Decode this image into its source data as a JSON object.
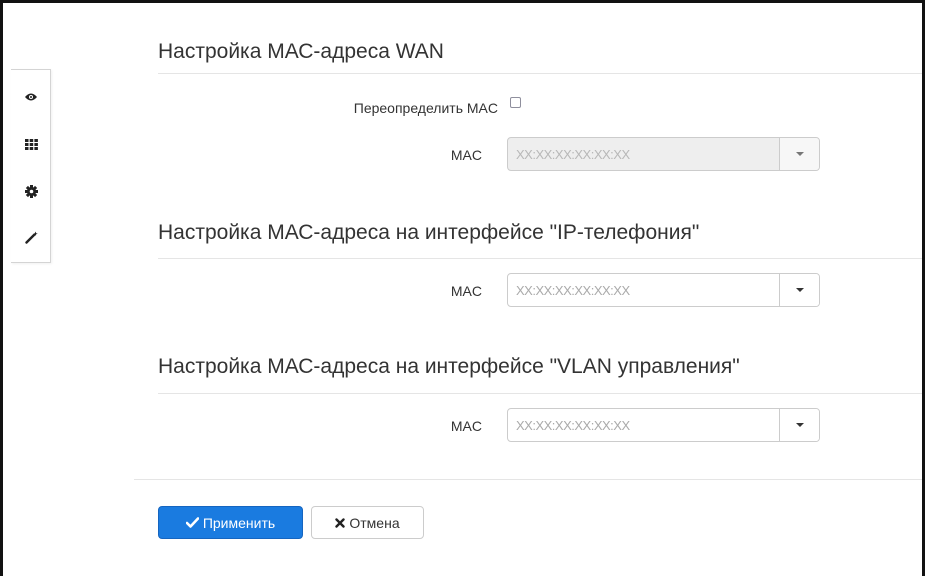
{
  "sidebar": {
    "items": [
      {
        "icon": "eye-icon"
      },
      {
        "icon": "grid-icon"
      },
      {
        "icon": "gear-icon"
      },
      {
        "icon": "wand-icon"
      }
    ]
  },
  "wan": {
    "title": "Настройка МАС-адреса WAN",
    "override_label": "Переопределить MAC",
    "override_checked": false,
    "mac_label": "MAC",
    "mac_placeholder": "XX:XX:XX:XX:XX:XX",
    "mac_value": ""
  },
  "iptel": {
    "title": "Настройка МАС-адреса на интерфейсе \"IP-телефония\"",
    "mac_label": "MAC",
    "mac_placeholder": "XX:XX:XX:XX:XX:XX",
    "mac_value": ""
  },
  "vlan": {
    "title": "Настройка МАС-адреса на интерфейсе \"VLAN управления\"",
    "mac_label": "MAC",
    "mac_placeholder": "XX:XX:XX:XX:XX:XX",
    "mac_value": ""
  },
  "actions": {
    "apply_label": "Применить",
    "cancel_label": "Отмена"
  },
  "colors": {
    "primary": "#1a7be0",
    "border": "#cccccc",
    "disabled_bg": "#eeeeee"
  }
}
